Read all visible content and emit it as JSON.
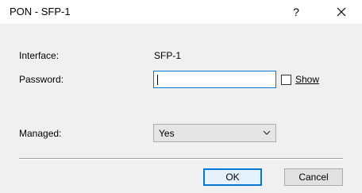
{
  "window": {
    "title": "PON - SFP-1",
    "help_label": "?"
  },
  "form": {
    "interface_label": "Interface:",
    "interface_value": "SFP-1",
    "password_label": "Password:",
    "password_value": "",
    "show_label": "Show",
    "show_checked": false,
    "managed_label": "Managed:",
    "managed_value": "Yes"
  },
  "buttons": {
    "ok": "OK",
    "cancel": "Cancel"
  }
}
